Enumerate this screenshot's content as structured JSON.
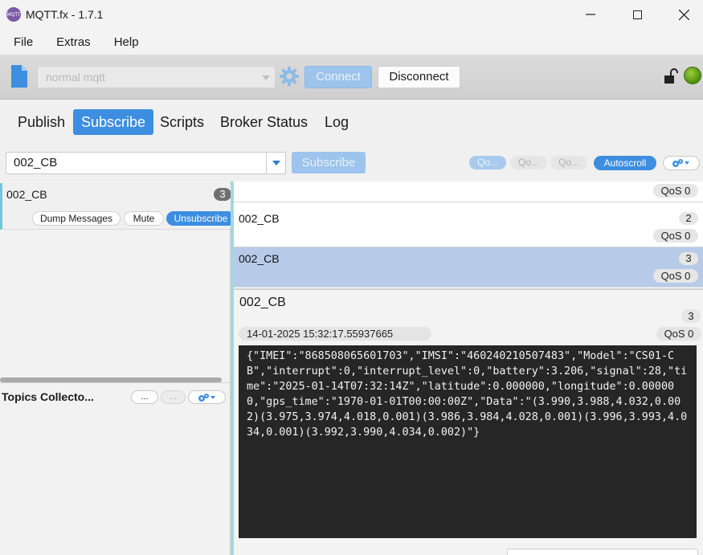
{
  "window": {
    "title": "MQTT.fx - 1.7.1",
    "app_icon_text": "MQTT"
  },
  "menu": [
    "File",
    "Extras",
    "Help"
  ],
  "toolbar": {
    "profile": "normal mqtt",
    "connect_label": "Connect",
    "disconnect_label": "Disconnect",
    "connection_status_color": "#5a9e1a",
    "accent_color": "#3d8ee0"
  },
  "tabs": [
    "Publish",
    "Subscribe",
    "Scripts",
    "Broker Status",
    "Log"
  ],
  "active_tab": "Subscribe",
  "subscribe_bar": {
    "topic": "002_CB",
    "subscribe_label": "Subscribe",
    "qos_buttons": [
      "Qo...",
      "Qo...",
      "Qo..."
    ],
    "autoscroll_label": "Autoscroll"
  },
  "subscriptions": [
    {
      "topic": "002_CB",
      "count": "3",
      "actions": {
        "dump": "Dump Messages",
        "mute": "Mute",
        "unsubscribe": "Unsubscribe"
      }
    }
  ],
  "topics_collector": {
    "label": "Topics Collecto...",
    "button_a": "...",
    "button_b": "..."
  },
  "messages": [
    {
      "topic": "",
      "number": "",
      "qos": "QoS 0"
    },
    {
      "topic": "002_CB",
      "number": "2",
      "qos": "QoS 0"
    },
    {
      "topic": "002_CB",
      "number": "3",
      "qos": "QoS 0"
    }
  ],
  "detail": {
    "topic": "002_CB",
    "number": "3",
    "timestamp": "14-01-2025  15:32:17.55937665",
    "qos": "QoS 0",
    "payload": "{\"IMEI\":\"868508065601703\",\"IMSI\":\"460240210507483\",\"Model\":\"CS01-CB\",\"interrupt\":0,\"interrupt_level\":0,\"battery\":3.206,\"signal\":28,\"time\":\"2025-01-14T07:32:14Z\",\"latitude\":0.000000,\"longitude\":0.000000,\"gps_time\":\"1970-01-01T00:00:00Z\",\"Data\":\"(3.990,3.988,4.032,0.002)(3.975,3.974,4.018,0.001)(3.986,3.984,4.028,0.001)(3.996,3.993,4.034,0.001)(3.992,3.990,4.034,0.002)\"}"
  }
}
